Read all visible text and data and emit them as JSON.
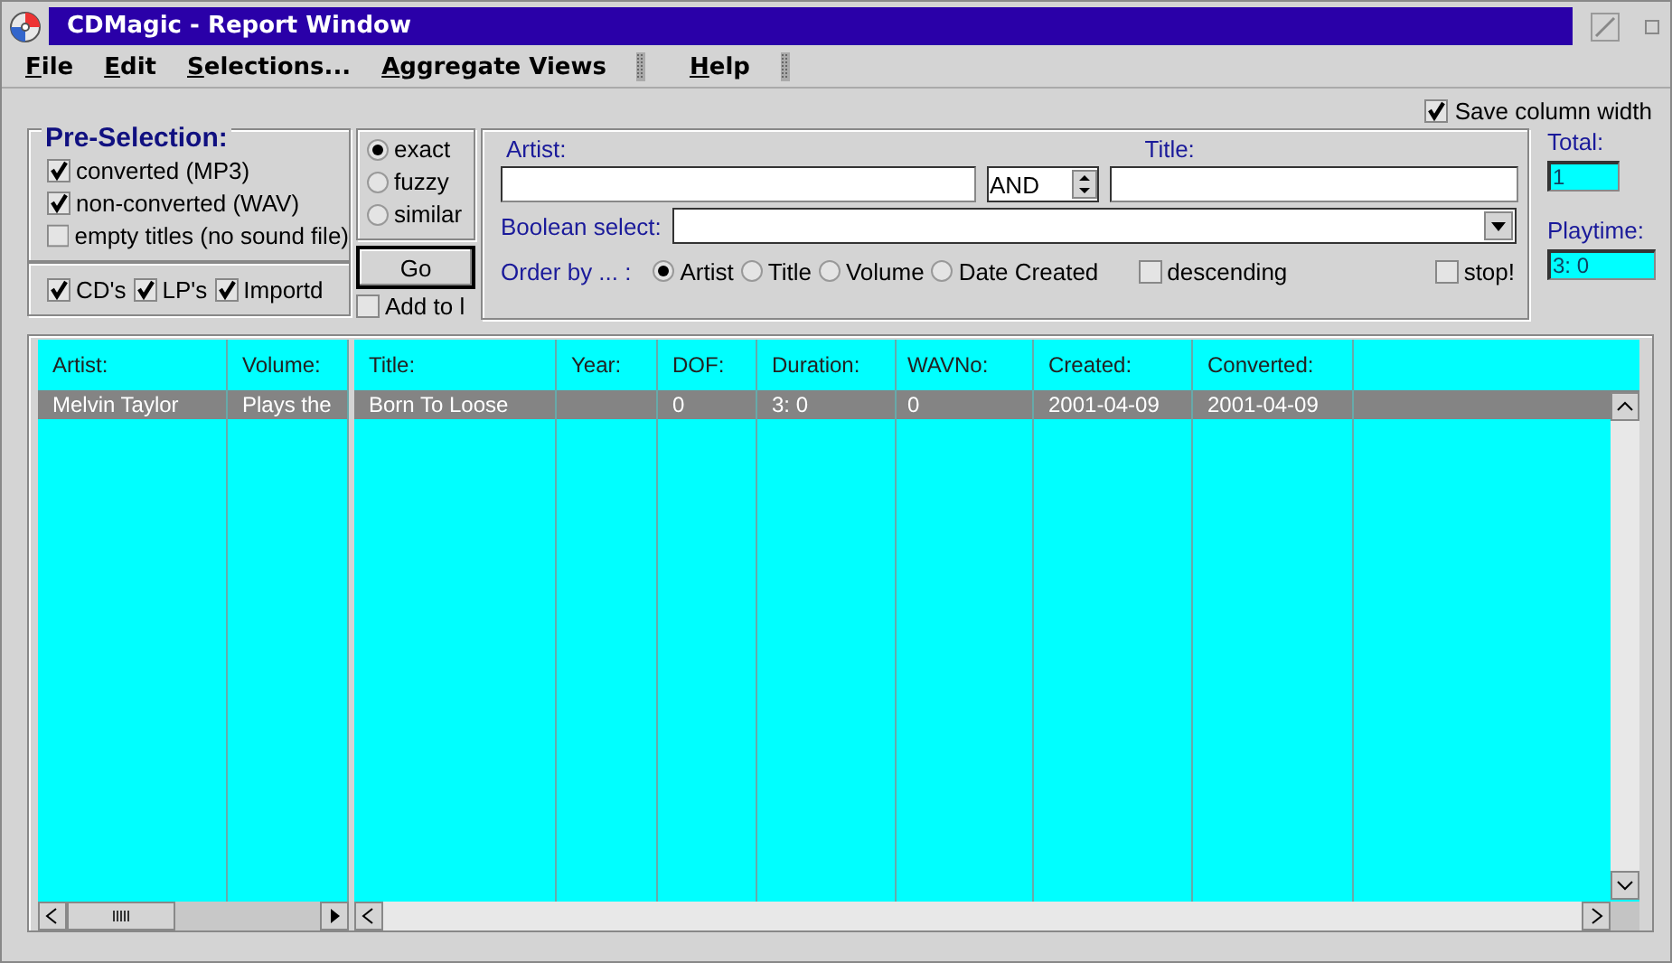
{
  "window": {
    "title": "CDMagic - Report Window"
  },
  "menu": [
    "File",
    "Edit",
    "Selections...",
    "Aggregate Views",
    "Help"
  ],
  "save_column_width": {
    "label": "Save column width",
    "checked": true
  },
  "pre_selection": {
    "title": "Pre-Selection:",
    "options": [
      {
        "label": "converted (MP3)",
        "checked": true
      },
      {
        "label": "non-converted (WAV)",
        "checked": true
      },
      {
        "label": "empty titles (no sound file)",
        "checked": false
      }
    ]
  },
  "media": [
    {
      "label": "CD's",
      "checked": true
    },
    {
      "label": "LP's",
      "checked": true
    },
    {
      "label": "Importd",
      "checked": true
    }
  ],
  "match_mode": [
    {
      "label": "exact",
      "selected": true
    },
    {
      "label": "fuzzy",
      "selected": false
    },
    {
      "label": "similar",
      "selected": false
    }
  ],
  "go_button": "Go",
  "add_to": {
    "label": "Add to l",
    "checked": false
  },
  "search": {
    "artist_label": "Artist:",
    "title_label": "Title:",
    "operator": "AND",
    "boolean_label": "Boolean select:",
    "order_label": "Order by ... :",
    "order_options": [
      {
        "label": "Artist",
        "selected": true
      },
      {
        "label": "Title",
        "selected": false
      },
      {
        "label": "Volume",
        "selected": false
      },
      {
        "label": "Date Created",
        "selected": false
      }
    ],
    "descending": {
      "label": "descending",
      "checked": false
    },
    "stop": {
      "label": "stop!",
      "checked": false
    }
  },
  "totals": {
    "total_label": "Total:",
    "total": "1",
    "playtime_label": "Playtime:",
    "playtime": "3: 0"
  },
  "table": {
    "fixed_columns": [
      "Artist:",
      "Volume:"
    ],
    "columns": [
      "Title:",
      "Year:",
      "DOF:",
      "Duration:",
      "WAVNo:",
      "Created:",
      "Converted:"
    ],
    "rows": [
      {
        "selected": true,
        "fixed_cells": [
          "Melvin Taylor",
          "Plays the"
        ],
        "cells": [
          "Born To Loose",
          null,
          "0",
          "3: 0",
          "0",
          "2001-04-09",
          "2001-04-09"
        ]
      }
    ]
  }
}
